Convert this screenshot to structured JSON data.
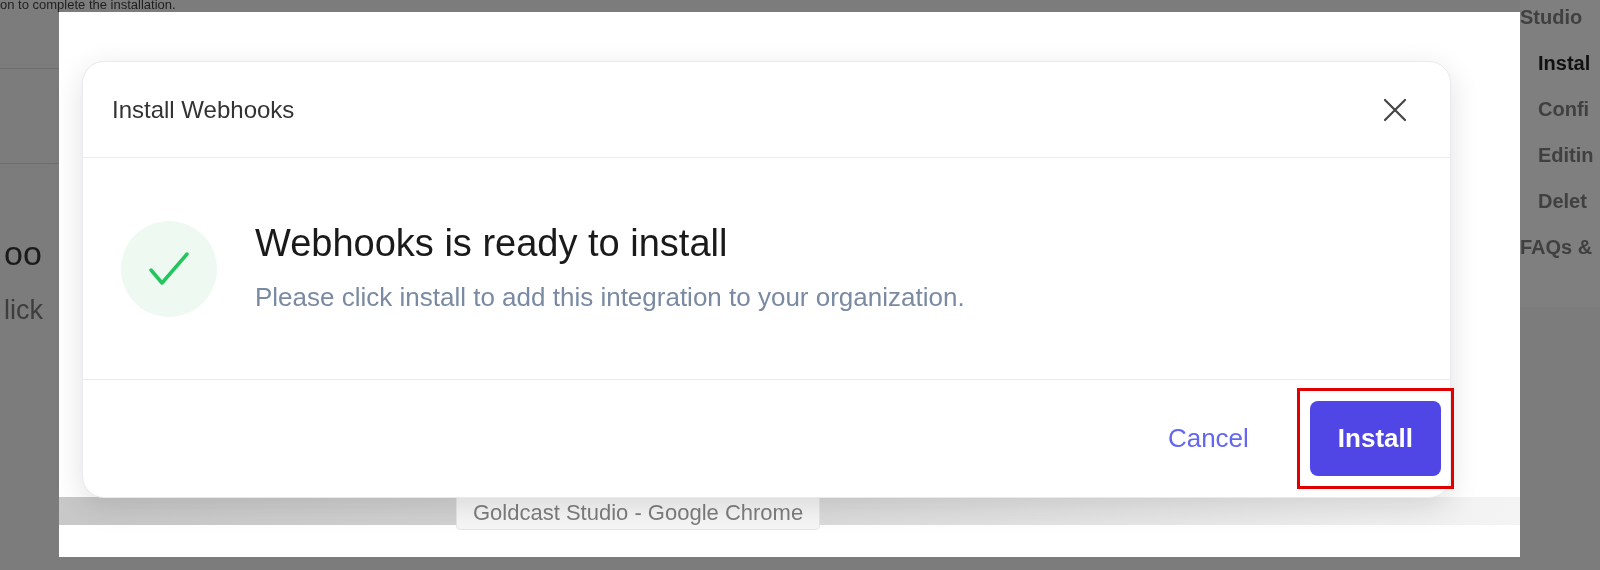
{
  "background_page": {
    "top_text": "on to complete the installation.",
    "heading": "oo",
    "text": "lick",
    "sidebar": [
      {
        "label": "Studio",
        "selected": false,
        "indented": false
      },
      {
        "label": "Instal",
        "selected": true,
        "indented": true
      },
      {
        "label": "Confi",
        "selected": false,
        "indented": true
      },
      {
        "label": "Editin",
        "selected": false,
        "indented": true
      },
      {
        "label": "Delet",
        "selected": false,
        "indented": true
      },
      {
        "label": "FAQs &",
        "selected": false,
        "indented": false
      }
    ]
  },
  "dialog": {
    "title": "Install Webhooks",
    "heading": "Webhooks is ready to install",
    "message": "Please click install to add this integration to your organization.",
    "buttons": [
      {
        "label": "Cancel",
        "kind": "secondary",
        "highlighted": false
      },
      {
        "label": "Install",
        "kind": "primary",
        "highlighted": true
      }
    ]
  },
  "tooltip": "Goldcast Studio - Google Chrome"
}
